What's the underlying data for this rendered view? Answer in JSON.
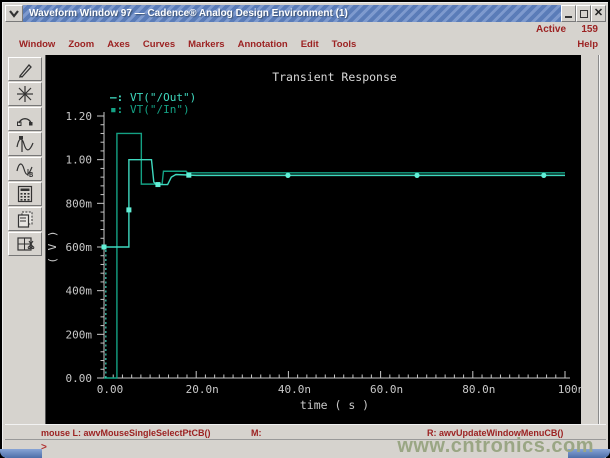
{
  "window": {
    "title": "Waveform Window 97 — Cadence® Analog Design Environment (1)",
    "controls": [
      "minimize",
      "maximize",
      "close"
    ],
    "close_glyph": "✕"
  },
  "active_row": {
    "label": "Active",
    "count": "159"
  },
  "menu": {
    "items": [
      "Window",
      "Zoom",
      "Axes",
      "Curves",
      "Markers",
      "Annotation",
      "Edit",
      "Tools"
    ],
    "help": "Help"
  },
  "toolbar": {
    "buttons": [
      {
        "icon": "pen-icon"
      },
      {
        "icon": "zoom-star-icon"
      },
      {
        "icon": "probe-arc-icon"
      },
      {
        "icon": "waveform-marker-a-icon"
      },
      {
        "icon": "waveform-marker-b-icon"
      },
      {
        "icon": "calculator-icon"
      },
      {
        "icon": "copy-window-icon"
      },
      {
        "icon": "split-window-cut-icon"
      }
    ]
  },
  "statusbar": {
    "mouse_l": "mouse L: awvMouseSingleSelectPtCB()",
    "m": "M:",
    "r": "R: awvUpdateWindowMenuCB()",
    "prompt": ">"
  },
  "watermark": "www.cntronics.com",
  "colors": {
    "titlebar_blue": "#5a7cb8",
    "menu_text_red": "#9c2222",
    "plot_bg": "#000000",
    "axis_gray": "#c8c8c8",
    "out_teal": "#3fd9bf",
    "in_green": "#14a184",
    "marker_bright": "#62eed6"
  },
  "chart_data": {
    "type": "line",
    "title": "Transient Response",
    "xlabel": "time ( s )",
    "ylabel": "( V )",
    "x_unit": "ns",
    "xlim": [
      0,
      100
    ],
    "ylim": [
      0,
      1.2
    ],
    "grid": false,
    "legend_position": "top-left",
    "x_ticks": {
      "values": [
        0,
        20,
        40,
        60,
        80,
        100
      ],
      "labels": [
        "0.00",
        "20.0n",
        "40.0n",
        "60.0n",
        "80.0n",
        "100n"
      ],
      "minor_step": 2
    },
    "y_ticks": {
      "values": [
        0,
        0.2,
        0.4,
        0.6,
        0.8,
        1.0,
        1.2
      ],
      "labels": [
        "0.00",
        "200m",
        "400m",
        "600m",
        "800m",
        "1.00",
        "1.20"
      ],
      "minor_step": 0.04
    },
    "series": [
      {
        "name": "VT(\"/Out\")",
        "legend_glyph": "—:",
        "color": "#3fd9bf",
        "points": [
          [
            0,
            0.6
          ],
          [
            5.4,
            0.6
          ],
          [
            5.4,
            1.0
          ],
          [
            10.3,
            1.0
          ],
          [
            10.8,
            0.898
          ],
          [
            11.3,
            0.886
          ],
          [
            13.8,
            0.886
          ],
          [
            14.6,
            0.92
          ],
          [
            15.6,
            0.932
          ],
          [
            20,
            0.928
          ],
          [
            100,
            0.928
          ]
        ],
        "dashed_segments": [
          [
            [
              0.4,
              0
            ],
            [
              0.4,
              0.6
            ]
          ]
        ],
        "markers": [
          [
            0,
            0.6,
            "square"
          ],
          [
            5.4,
            0.77,
            "square"
          ],
          [
            11.7,
            0.886,
            "square"
          ],
          [
            18.4,
            0.929,
            "square"
          ],
          [
            39.9,
            0.928,
            "dot"
          ],
          [
            67.9,
            0.928,
            "dot"
          ],
          [
            95.4,
            0.928,
            "dot"
          ]
        ]
      },
      {
        "name": "VT(\"/In\")",
        "legend_glyph": "▪:",
        "color": "#14a184",
        "points": [
          [
            0,
            0
          ],
          [
            2.8,
            0
          ],
          [
            2.8,
            1.12
          ],
          [
            8.1,
            1.12
          ],
          [
            8.1,
            0.888
          ],
          [
            12.6,
            0.888
          ],
          [
            12.9,
            0.947
          ],
          [
            17.8,
            0.947
          ],
          [
            18.1,
            0.94
          ],
          [
            100,
            0.94
          ]
        ],
        "dashed_segments": [],
        "markers": []
      }
    ]
  }
}
